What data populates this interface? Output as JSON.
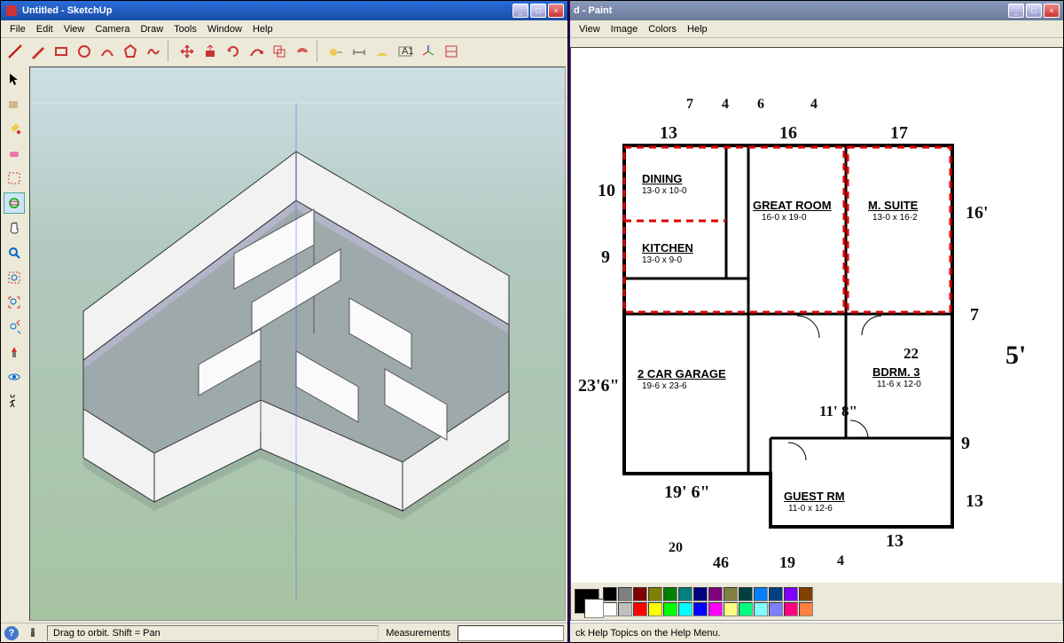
{
  "sketchup": {
    "title": "Untitled - SketchUp",
    "menu": [
      "File",
      "Edit",
      "View",
      "Camera",
      "Draw",
      "Tools",
      "Window",
      "Help"
    ],
    "status_hint": "Drag to orbit.  Shift = Pan",
    "measurements_label": "Measurements"
  },
  "paint": {
    "title": "d - Paint",
    "menu": [
      "View",
      "Image",
      "Colors",
      "Help"
    ],
    "status": "ck Help Topics on the Help Menu.",
    "palette": [
      [
        "#000000",
        "#808080",
        "#800000",
        "#808000",
        "#008000",
        "#008080",
        "#000080",
        "#800080",
        "#808040",
        "#004040",
        "#0080ff",
        "#004080",
        "#8000ff",
        "#804000"
      ],
      [
        "#ffffff",
        "#c0c0c0",
        "#ff0000",
        "#ffff00",
        "#00ff00",
        "#00ffff",
        "#0000ff",
        "#ff00ff",
        "#ffff80",
        "#00ff80",
        "#80ffff",
        "#8080ff",
        "#ff0080",
        "#ff8040"
      ]
    ]
  },
  "floorplan": {
    "rooms": {
      "dining": {
        "label": "DINING",
        "dims": "13-0 x 10-0"
      },
      "kitchen": {
        "label": "KITCHEN",
        "dims": "13-0 x 9-0"
      },
      "great": {
        "label": "GREAT ROOM",
        "dims": "16-0 x 19-0"
      },
      "msuite": {
        "label": "M. SUITE",
        "dims": "13-0 x 16-2"
      },
      "garage": {
        "label": "2 CAR GARAGE",
        "dims": "19-6 x 23-6"
      },
      "bdrm3": {
        "label": "BDRM. 3",
        "dims": "11-6 x 12-0"
      },
      "guest": {
        "label": "GUEST RM",
        "dims": "11-0 x 12-6"
      }
    },
    "handwritten": {
      "top_a": "7",
      "top_b": "4",
      "top_c": "6",
      "top_d": "4",
      "top_13": "13",
      "top_16": "16",
      "top_17": "17",
      "left_10": "10",
      "left_9": "9",
      "left_23_6": "23'6\"",
      "right_16": "16'",
      "right_7": "7",
      "right_5ish": "5'",
      "mid_11_8": "11' 8\"",
      "mid_22": "22",
      "bottom_19_6": "19' 6\"",
      "bottom_9": "9",
      "bottom_13a": "13",
      "bottom_13b": "13",
      "bottom_46": "46",
      "bottom_20": "20",
      "bottom_19": "19",
      "bottom_4": "4"
    }
  }
}
